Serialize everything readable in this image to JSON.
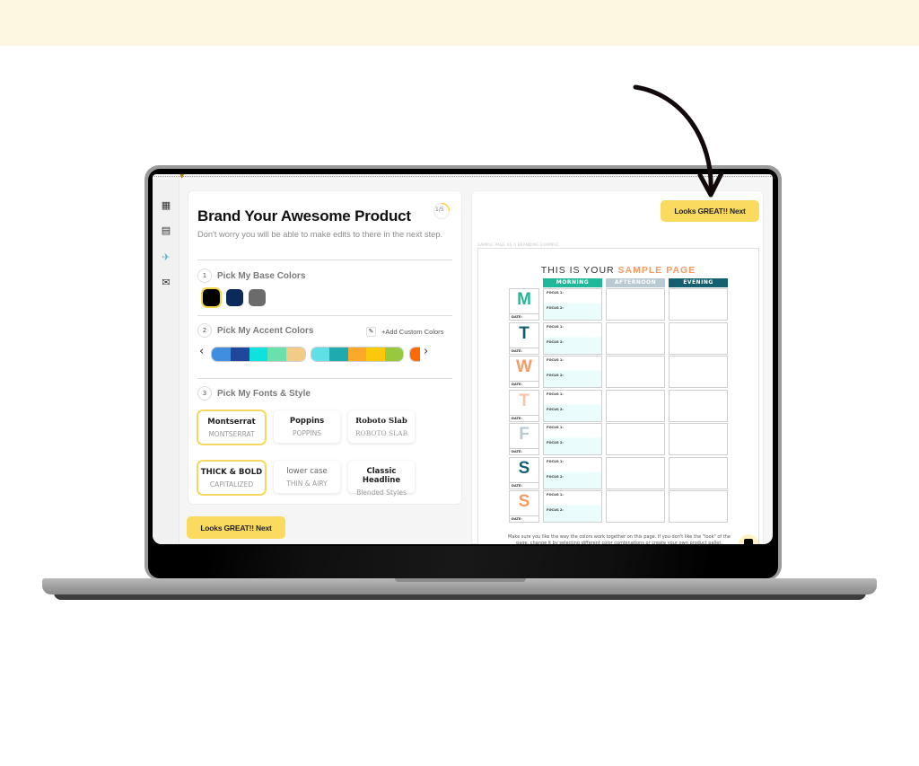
{
  "app": {
    "title": "Brand Your Awesome Product",
    "subtitle": "Don't worry you will be able to make edits to there in the next step.",
    "progress": {
      "label": "1/5",
      "current": 1,
      "total": 5
    }
  },
  "sidebar": {
    "items": [
      {
        "icon": "grid-icon",
        "glyph": "▦"
      },
      {
        "icon": "document-icon",
        "glyph": "▤"
      },
      {
        "icon": "rocket-icon",
        "glyph": "✈"
      },
      {
        "icon": "mail-icon",
        "glyph": "✉"
      }
    ]
  },
  "steps": {
    "base_colors": {
      "number": "1",
      "label": "Pick My Base Colors",
      "swatches": [
        {
          "color": "#000000",
          "selected": true
        },
        {
          "color": "#0b2a5b",
          "selected": false
        },
        {
          "color": "#6b6b6b",
          "selected": false
        }
      ]
    },
    "accent_colors": {
      "number": "2",
      "label": "Pick My Accent Colors",
      "add_custom_label": "+Add Custom Colors",
      "palettes": [
        [
          "#3f8ee0",
          "#21479c",
          "#0fe1dd",
          "#6ae0ad",
          "#f2cc87"
        ],
        [
          "#5fe0e6",
          "#1faab0",
          "#fca82a",
          "#fcc80c",
          "#98c93c"
        ],
        [
          "#ff6a00"
        ]
      ]
    },
    "fonts_style": {
      "number": "3",
      "label": "Pick My Fonts & Style",
      "fonts": [
        {
          "main": "Montserrat",
          "sub": "MONTSERRAT",
          "selected": true
        },
        {
          "main": "Poppins",
          "sub": "POPPINS",
          "selected": false
        },
        {
          "main": "Roboto Slab",
          "sub": "ROBOTO SLAB",
          "selected": false
        }
      ],
      "styles": [
        {
          "main": "THICK & BOLD",
          "sub": "CAPITALIZED",
          "selected": true
        },
        {
          "main": "lower case",
          "sub": "THIN & AIRY",
          "selected": false
        },
        {
          "main": "Classic Headline",
          "sub": "Blended Styles",
          "selected": false
        }
      ]
    }
  },
  "buttons": {
    "next_bottom": "Looks GREAT!! Next",
    "next_top": "Looks GREAT!! Next"
  },
  "sample": {
    "caption": "SAMPLE PAGE AS A BRANDING EXAMPLE",
    "title_prefix": "THIS IS YOUR",
    "title_accent": "SAMPLE PAGE",
    "columns": [
      {
        "label": "MORNING",
        "color": "#1fb89a"
      },
      {
        "label": "AFTERNOON",
        "color": "#b8c9d1"
      },
      {
        "label": "EVENING",
        "color": "#145f70"
      }
    ],
    "days": [
      {
        "letter": "M",
        "color": "#1fb89a"
      },
      {
        "letter": "T",
        "color": "#145f70"
      },
      {
        "letter": "W",
        "color": "#f79b66"
      },
      {
        "letter": "T",
        "color": "#f9c3a8"
      },
      {
        "letter": "F",
        "color": "#b8c9d1"
      },
      {
        "letter": "S",
        "color": "#145f70"
      },
      {
        "letter": "S",
        "color": "#f79b66"
      }
    ],
    "date_label": "DATE:",
    "focus1_label": "FOCUS 1:",
    "focus2_label": "FOCUS 2:",
    "footer": "Make sure you like the way the colors work together on this page.  If you don't like the \"look\" of the page, change it by selecting different color combinations or create your own product pallet."
  },
  "colors": {
    "accent_yellow": "#fbdb5d",
    "page_band": "#fdf6e1"
  }
}
